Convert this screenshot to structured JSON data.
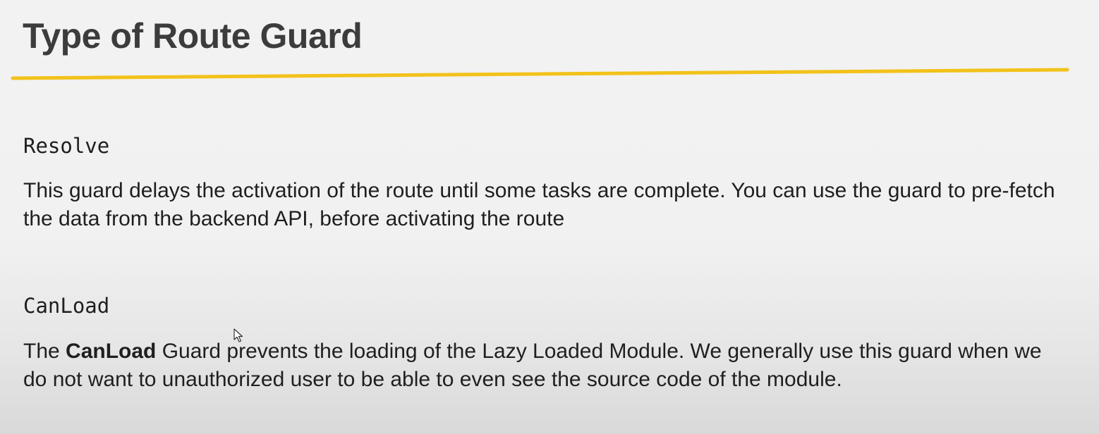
{
  "slide": {
    "title": "Type of Route Guard",
    "accent_color": "#f2c21a",
    "sections": [
      {
        "name": "Resolve",
        "description": "This guard delays the activation of the route until some tasks are complete. You can use the guard to pre-fetch the data from the backend API, before activating the route"
      },
      {
        "name": "CanLoad",
        "description_prefix": "The ",
        "description_bold": "CanLoad",
        "description_rest": " Guard prevents the loading of the Lazy Loaded Module. We generally use this guard when we do not want to unauthorized user to be able to even see the source code of the module."
      }
    ]
  },
  "cursor": {
    "icon": "mouse-pointer-icon"
  }
}
